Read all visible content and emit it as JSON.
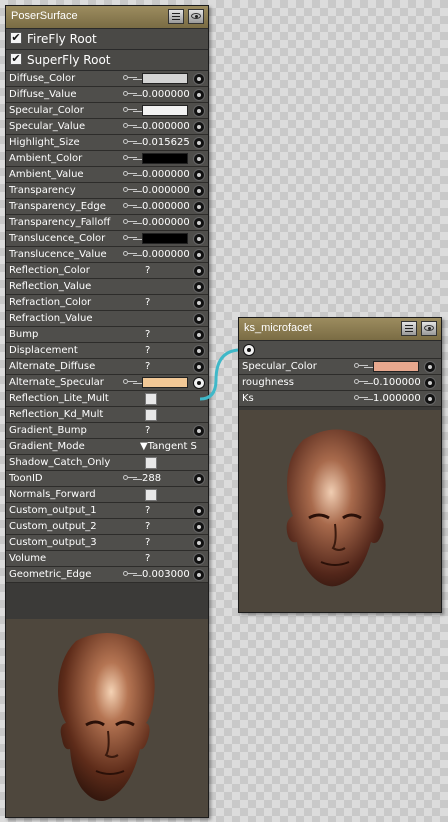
{
  "poser_node": {
    "title": "PoserSurface",
    "roots": [
      {
        "label": "FireFly Root",
        "checked": true
      },
      {
        "label": "SuperFly Root",
        "checked": true
      }
    ],
    "params": [
      {
        "name": "Diffuse_Color",
        "color": "#d4d4d4"
      },
      {
        "name": "Diffuse_Value",
        "value": "0.000000"
      },
      {
        "name": "Specular_Color",
        "color": "#f2f2f2"
      },
      {
        "name": "Specular_Value",
        "value": "0.000000"
      },
      {
        "name": "Highlight_Size",
        "value": "0.015625"
      },
      {
        "name": "Ambient_Color",
        "color": "#000000"
      },
      {
        "name": "Ambient_Value",
        "value": "0.000000"
      },
      {
        "name": "Transparency",
        "value": "0.000000"
      },
      {
        "name": "Transparency_Edge",
        "value": "0.000000"
      },
      {
        "name": "Transparency_Falloff",
        "value": "0.000000"
      },
      {
        "name": "Translucence_Color",
        "color": "#000000"
      },
      {
        "name": "Translucence_Value",
        "value": "0.000000"
      },
      {
        "name": "Reflection_Color",
        "q": "?"
      },
      {
        "name": "Reflection_Value"
      },
      {
        "name": "Refraction_Color",
        "q": "?"
      },
      {
        "name": "Refraction_Value"
      },
      {
        "name": "Bump",
        "q": "?"
      },
      {
        "name": "Displacement",
        "q": "?"
      },
      {
        "name": "Alternate_Diffuse",
        "q": "?"
      },
      {
        "name": "Alternate_Specular",
        "color": "#f2c896",
        "linked": true
      },
      {
        "name": "Reflection_Lite_Mult",
        "checkbox": true
      },
      {
        "name": "Reflection_Kd_Mult",
        "checkbox": true
      },
      {
        "name": "Gradient_Bump",
        "q": "?"
      },
      {
        "name": "Gradient_Mode",
        "dropdown": "▼Tangent S"
      },
      {
        "name": "Shadow_Catch_Only",
        "checkbox": true
      },
      {
        "name": "ToonID",
        "value": "288"
      },
      {
        "name": "Normals_Forward",
        "checkbox": true
      },
      {
        "name": "Custom_output_1",
        "q": "?"
      },
      {
        "name": "Custom_output_2",
        "q": "?"
      },
      {
        "name": "Custom_output_3",
        "q": "?"
      },
      {
        "name": "Volume",
        "q": "?"
      },
      {
        "name": "Geometric_Edge",
        "value": "0.003000"
      }
    ]
  },
  "micro_node": {
    "title": "ks_microfacet",
    "params": [
      {
        "name": "Specular_Color",
        "color": "#e8a88e"
      },
      {
        "name": "roughness",
        "value": "0.100000"
      },
      {
        "name": "Ks",
        "value": "1.000000"
      }
    ]
  },
  "colors": {
    "node_bg": "#3b3a38",
    "row_bg": "#4f4e4b",
    "header_gold": "#8a7a50",
    "link_wire": "#3fb8c8",
    "preview_bg": "#4e473d"
  },
  "icons": [
    "menu-icon",
    "eye-icon",
    "key-icon",
    "plug-icon",
    "output-plug-icon"
  ]
}
